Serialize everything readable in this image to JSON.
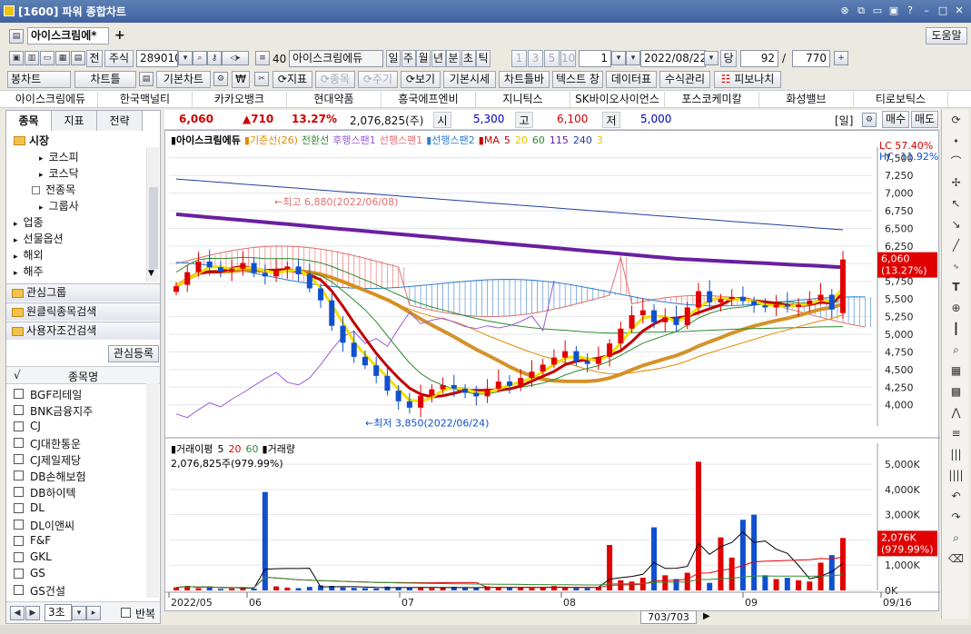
{
  "window": {
    "title": "[1600] 파워 종합차트",
    "buttons": [
      "⊗",
      "⧉",
      "▭",
      "▣",
      "?",
      "–",
      "□",
      "✕"
    ]
  },
  "doc_tab": {
    "name": "아이스크림에*",
    "add": "+",
    "help": "도움말"
  },
  "toolbar": {
    "prefix1": "전",
    "prefix2": "주식",
    "code": "289010",
    "period_num": "40",
    "stock_name": "아이스크림에듀",
    "period_labels": [
      "일",
      "주",
      "월",
      "년",
      "분",
      "초",
      "틱"
    ],
    "intervals": [
      "1",
      "3",
      "5",
      "10"
    ],
    "interval_sel": "1",
    "date": "2022/08/22",
    "unit": "당",
    "count1": "92",
    "sep": "/",
    "count2": "770"
  },
  "toolbar2": {
    "buttons": [
      "봉차트",
      "차트틀",
      "기본차트",
      "지표",
      "종목",
      "주기",
      "보기",
      "기본시세",
      "차트틀바",
      "텍스트 창",
      "데이터표",
      "수식관리",
      "피보나치"
    ],
    "won": "₩"
  },
  "stock_bar": [
    "아이스크림에듀",
    "한국맥널티",
    "카카오뱅크",
    "현대약품",
    "흥국에프엔비",
    "지니틱스",
    "SK바이오사이언스",
    "포스코케미칼",
    "화성밸브",
    "티로보틱스"
  ],
  "left": {
    "tabs": [
      "종목",
      "지표",
      "전략"
    ],
    "tree": [
      {
        "label": "시장",
        "level": 0,
        "type": "folder"
      },
      {
        "label": "코스피",
        "level": 2,
        "type": "arrow"
      },
      {
        "label": "코스닥",
        "level": 2,
        "type": "arrow"
      },
      {
        "label": "전종목",
        "level": 1,
        "type": "doc"
      },
      {
        "label": "그룹사",
        "level": 2,
        "type": "arrow"
      },
      {
        "label": "업종",
        "level": 0,
        "type": "arrow"
      },
      {
        "label": "선물옵션",
        "level": 0,
        "type": "arrow"
      },
      {
        "label": "해외",
        "level": 0,
        "type": "arrow"
      },
      {
        "label": "해주",
        "level": 0,
        "type": "arrow"
      }
    ],
    "groups": [
      "관심그룹",
      "원클릭종목검색",
      "사용자조건검색"
    ],
    "watch_button": "관심등록",
    "list_header_check": "√",
    "list_header": "종목명",
    "list": [
      "BGF리테일",
      "BNK금융지주",
      "CJ",
      "CJ대한통운",
      "CJ제일제당",
      "DB손해보험",
      "DB하이텍",
      "DL",
      "DL이앤씨",
      "F&F",
      "GKL",
      "GS",
      "GS건설"
    ],
    "bottom_interval": "3초",
    "bottom_repeat": "반복"
  },
  "info": {
    "price": "6,060",
    "change": "▲710",
    "pct": "13.27%",
    "volume": "2,076,825(주)",
    "open_lbl": "시",
    "open": "5,300",
    "high_lbl": "고",
    "high": "6,100",
    "low_lbl": "저",
    "low": "5,000",
    "period": "[일]",
    "buy": "매수",
    "sell": "매도"
  },
  "chart_data": [
    {
      "type": "candlestick",
      "legend": {
        "name": "아이스크림에듀",
        "ichimoku": [
          {
            "label": "기준선(26)",
            "color": "#e08a00"
          },
          {
            "label": "전환선",
            "color": "#2e8b2e"
          },
          {
            "label": "후행스팬1",
            "color": "#9a5bd6"
          },
          {
            "label": "선행스팬1",
            "color": "#e07070"
          },
          {
            "label": "선행스팬2",
            "color": "#2f7fd0"
          }
        ],
        "ma_label": "MA",
        "ma": [
          {
            "label": "5",
            "color": "#c00000"
          },
          {
            "label": "20",
            "color": "#e8c000"
          },
          {
            "label": "60",
            "color": "#2e8b2e"
          },
          {
            "label": "115",
            "color": "#6a1fa0"
          },
          {
            "label": "240",
            "color": "#2040a0"
          },
          {
            "label": "3",
            "color": "#e8c000"
          }
        ]
      },
      "lc_lbl": "LC",
      "lc": "57.40%",
      "hc_lbl": "HC",
      "hc": "-11.92%",
      "y_ticks": [
        "7,500",
        "7,250",
        "7,000",
        "6,750",
        "6,500",
        "6,250",
        "6,000",
        "5,750",
        "5,500",
        "5,250",
        "5,000",
        "4,750",
        "4,500",
        "4,250",
        "4,000"
      ],
      "ylim": [
        3700,
        7600
      ],
      "current": "6,060",
      "current_pct": "(13.27%)",
      "annot_high": "←최고 6,880(2022/06/08)",
      "annot_low": "←최저 3,850(2022/06/24)",
      "closes": [
        5680,
        5880,
        6030,
        5950,
        5890,
        5930,
        6010,
        5870,
        5820,
        5920,
        5960,
        5850,
        5650,
        5480,
        5120,
        4880,
        4680,
        4560,
        4410,
        4200,
        4050,
        3960,
        4130,
        4220,
        4280,
        4230,
        4170,
        4120,
        4230,
        4330,
        4270,
        4380,
        4470,
        4570,
        4670,
        4760,
        4620,
        4580,
        4680,
        4870,
        5080,
        5270,
        5340,
        5170,
        5240,
        5130,
        5380,
        5610,
        5450,
        5500,
        5530,
        5470,
        5410,
        5380,
        5420,
        5390,
        5420,
        5480,
        5560,
        5350,
        6060
      ],
      "opens": [
        5600,
        5700,
        5880,
        6030,
        5950,
        5890,
        5930,
        6010,
        5870,
        5820,
        5920,
        5960,
        5850,
        5650,
        5480,
        5120,
        4880,
        4680,
        4560,
        4410,
        4200,
        4050,
        3960,
        4130,
        4220,
        4280,
        4230,
        4170,
        4120,
        4230,
        4330,
        4270,
        4380,
        4470,
        4570,
        4670,
        4760,
        4620,
        4580,
        4680,
        4870,
        5080,
        5270,
        5340,
        5170,
        5240,
        5130,
        5380,
        5610,
        5450,
        5500,
        5530,
        5470,
        5410,
        5380,
        5420,
        5390,
        5420,
        5480,
        5560,
        5300
      ]
    },
    {
      "type": "bar",
      "legend_title": "거래이평",
      "legend_ma": [
        {
          "label": "5",
          "color": "#000000"
        },
        {
          "label": "20",
          "color": "#e00000"
        },
        {
          "label": "60",
          "color": "#2e8b2e"
        }
      ],
      "legend_vol": "거래량",
      "value_text": "2,076,825주(979.99%)",
      "y_ticks": [
        "5,000K",
        "4,000K",
        "3,000K",
        "2,000K",
        "1,000K",
        "0K"
      ],
      "ylim": [
        0,
        5400
      ],
      "current": "2,076K",
      "current_pct": "(979.99%)",
      "values": [
        120,
        180,
        90,
        140,
        60,
        80,
        100,
        70,
        3900,
        160,
        110,
        90,
        140,
        200,
        180,
        120,
        100,
        90,
        80,
        150,
        130,
        110,
        100,
        90,
        120,
        140,
        100,
        90,
        160,
        120,
        130,
        110,
        90,
        140,
        170,
        120,
        100,
        90,
        130,
        1800,
        400,
        350,
        500,
        2500,
        600,
        450,
        700,
        5100,
        300,
        2100,
        1300,
        2800,
        3000,
        600,
        450,
        500,
        400,
        350,
        1100,
        1400,
        2076
      ],
      "x_ticks": [
        "2022/05",
        "06",
        "07",
        "08",
        "09",
        "09/16"
      ]
    }
  ],
  "status": {
    "page": "703/703",
    "ff": "▶"
  }
}
